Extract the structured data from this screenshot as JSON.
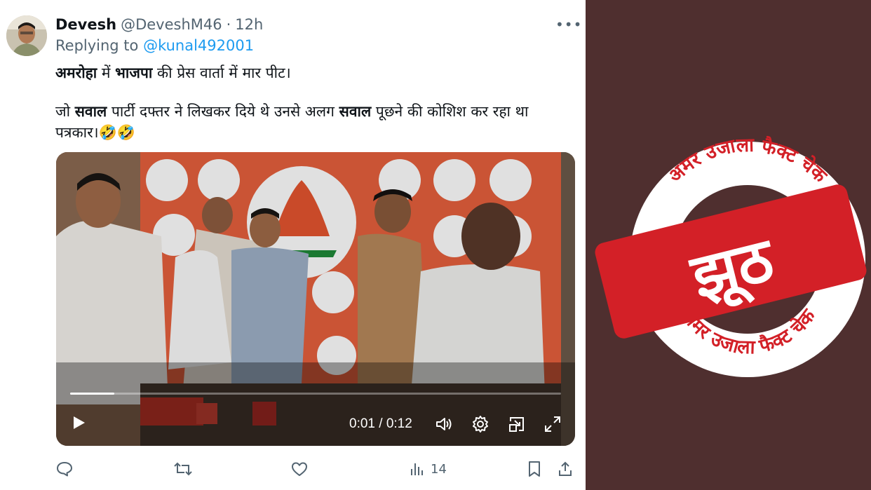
{
  "tweet": {
    "author_name": "Devesh",
    "handle": "@DeveshM46",
    "separator": "·",
    "time": "12h",
    "more_label": "•••",
    "replying_prefix": "Replying to",
    "replying_handle": "@kunal492001",
    "line1": {
      "p1": "अमरोहा",
      "p2": " में ",
      "p3": "भाजपा",
      "p4": " की प्रेस वार्ता में मार पीट।"
    },
    "line2": {
      "p1": "जो ",
      "p2": "सवाल",
      "p3": " पार्टी दफ्तर ने लिखकर दिये थे उनसे अलग ",
      "p4": "सवाल",
      "p5": " पूछने की कोशिश कर रहा था"
    },
    "line3": "पत्रकार।🤣🤣"
  },
  "video": {
    "current_time": "0:01",
    "duration": "0:12",
    "time_display": "0:01 / 0:12",
    "progress_fraction": 0.09
  },
  "actions": {
    "views_count": "14"
  },
  "stamp": {
    "top_text": "अमर उजाला फैक्ट चेक",
    "bottom_text": "अमर उजाला फैक्ट चेक",
    "verdict": "झूठ"
  },
  "colors": {
    "right_bg": "#4f2f2f",
    "stamp_red": "#d32027",
    "link_blue": "#1d9bf0",
    "secondary_text": "#536471"
  }
}
